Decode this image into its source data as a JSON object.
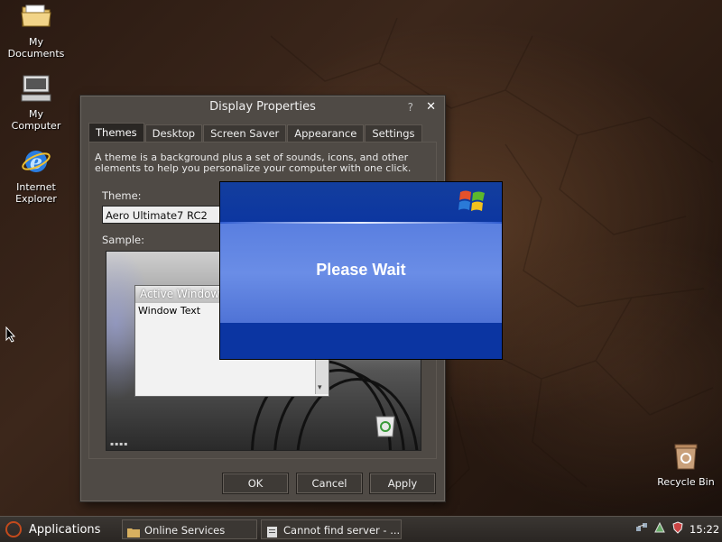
{
  "desktop": {
    "icons": [
      {
        "label_line1": "My",
        "label_line2": "Documents"
      },
      {
        "label_line1": "My",
        "label_line2": "Computer"
      },
      {
        "label_line1": "Internet",
        "label_line2": "Explorer"
      },
      {
        "label_line1": "Recycle Bin",
        "label_line2": ""
      }
    ]
  },
  "display_properties": {
    "title": "Display Properties",
    "help": "?",
    "close": "✕",
    "tabs": [
      "Themes",
      "Desktop",
      "Screen Saver",
      "Appearance",
      "Settings"
    ],
    "active_tab": "Themes",
    "description": "A theme is a background plus a set of sounds, icons, and other elements to help you personalize your computer with one click.",
    "theme_label": "Theme:",
    "theme_value": "Aero Ultimate7 RC2",
    "sample_label": "Sample:",
    "sample": {
      "window_title": "Active Window",
      "window_text": "Window Text",
      "scroll_arrow": "▾"
    },
    "buttons": {
      "ok": "OK",
      "cancel": "Cancel",
      "apply": "Apply"
    }
  },
  "please_wait": {
    "message": "Please Wait"
  },
  "taskbar": {
    "applications": "Applications",
    "tasks": [
      "Online Services",
      "Cannot find server - ..."
    ],
    "clock": "15:22"
  },
  "colors": {
    "dialog_blue": "#0b35a2",
    "panel_gray": "#4f4a45",
    "accent_orange": "#c24a1c"
  }
}
